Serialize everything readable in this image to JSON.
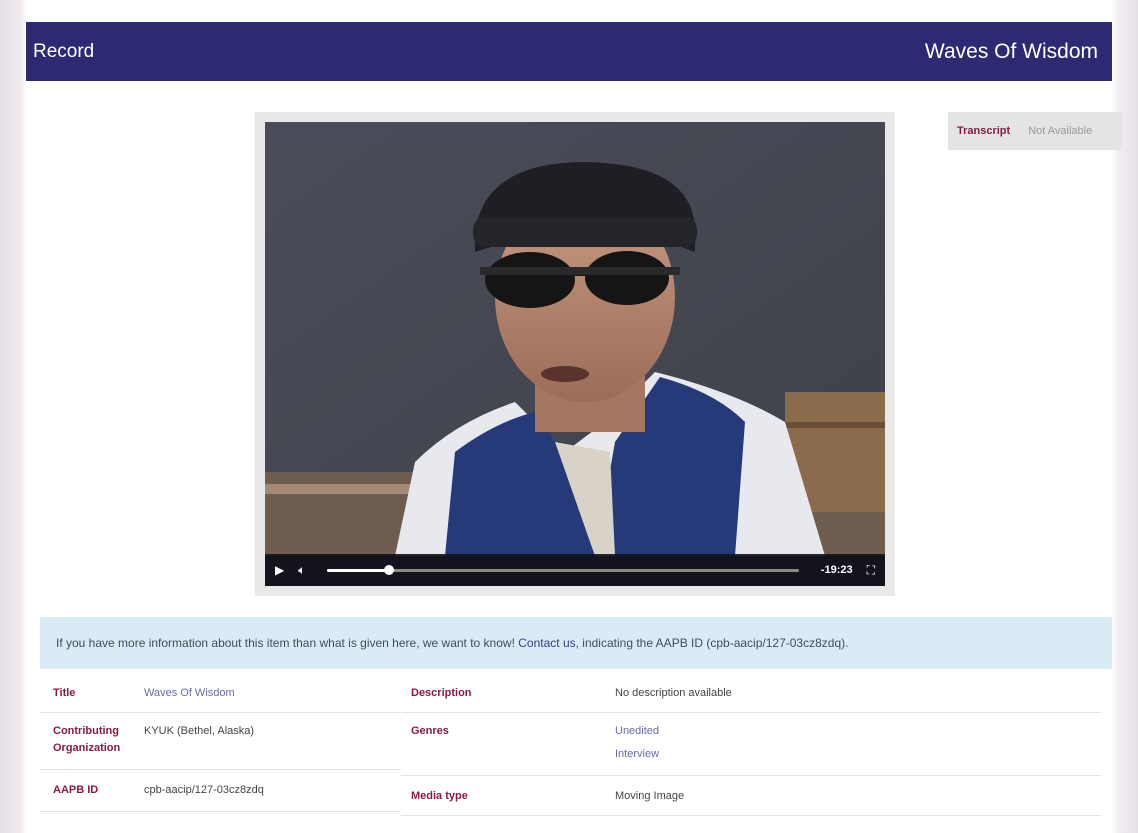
{
  "header": {
    "left_title": "Record",
    "right_title": "Waves Of Wisdom"
  },
  "player": {
    "time_remaining": "-19:23",
    "progress_fraction": 0.13,
    "play_icon": "play-icon",
    "volume_icon": "volume-icon",
    "fullscreen_icon": "fullscreen-icon"
  },
  "transcript": {
    "label": "Transcript",
    "value": "Not Available"
  },
  "alert": {
    "text_before": "If you have more information about this item than what is given here, we want to know! ",
    "link_text": "Contact us",
    "text_after": ", indicating the AAPB ID (cpb-aacip/127-03cz8zdq)."
  },
  "metadata_left": [
    {
      "key": "Title",
      "value": "Waves Of Wisdom"
    },
    {
      "key": "Contributing Organization",
      "value": "KYUK (Bethel, Alaska)"
    },
    {
      "key": "AAPB ID",
      "value": "cpb-aacip/127-03cz8zdq"
    }
  ],
  "metadata_right": [
    {
      "key": "Description",
      "value": "No description available"
    },
    {
      "key": "Genres",
      "values": [
        "Unedited",
        "Interview"
      ]
    },
    {
      "key": "Media type",
      "value": "Moving Image"
    }
  ],
  "colors": {
    "header_bg": "#2b2a73",
    "label_accent": "#8a1a46",
    "alert_bg": "#d9ecf5",
    "link": "#6a6aa8"
  }
}
